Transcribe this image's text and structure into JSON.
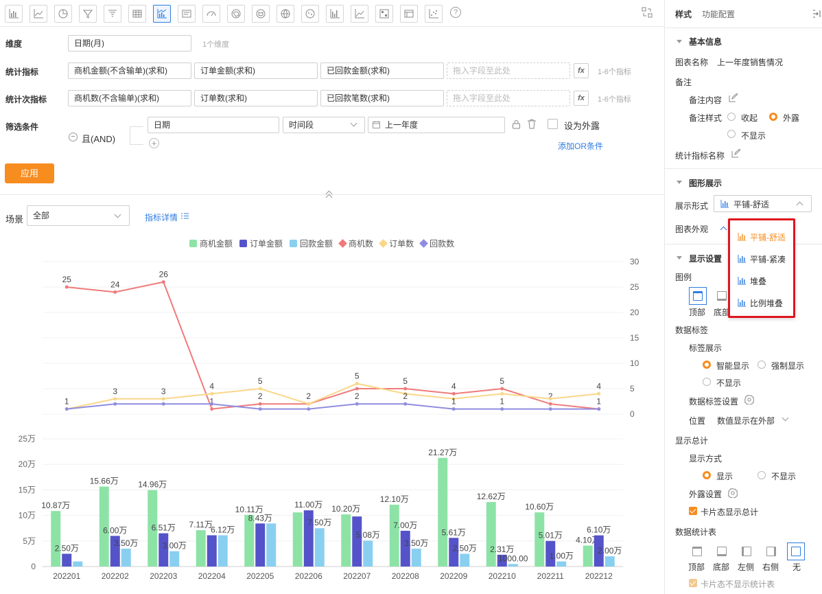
{
  "toolbar": {
    "icons": [
      "bar-chart-icon",
      "line-chart-icon",
      "pie-chart-icon",
      "funnel-icon",
      "funnel-bars-icon",
      "table-icon",
      "combo-chart-icon",
      "text-card-icon",
      "gauge-icon",
      "map-cn-icon",
      "map-cn-alt-icon",
      "globe-icon",
      "scatter-map-icon",
      "column-icon",
      "area-chart-icon",
      "heat-grid-icon",
      "list-table-icon",
      "scatter-icon"
    ],
    "active_index": 6,
    "help": "?"
  },
  "config": {
    "dimension_label": "维度",
    "dimension_value": "日期(月)",
    "dimension_hint": "1个维度",
    "metric_label": "统计指标",
    "metrics": [
      "商机金额(不含输单)(求和)",
      "订单金额(求和)",
      "已回款金额(求和)"
    ],
    "metric_placeholder": "拖入字段至此处",
    "metric_hint": "1-6个指标",
    "fx": "fx",
    "submetric_label": "统计次指标",
    "submetrics": [
      "商机数(不含输单)(求和)",
      "订单数(求和)",
      "已回款笔数(求和)"
    ],
    "submetric_placeholder": "拖入字段至此处",
    "submetric_hint": "1-6个指标",
    "filter_label": "筛选条件",
    "filter_and": "且(AND)",
    "filter_field": "日期",
    "filter_op": "时间段",
    "filter_value": "上一年度",
    "filter_expose": "设为外露",
    "add_or": "添加OR条件",
    "apply": "应用"
  },
  "scene": {
    "label": "场景",
    "value": "全部",
    "detail_link": "指标详情"
  },
  "chart_data": {
    "type": "bar",
    "categories": [
      "202201",
      "202202",
      "202203",
      "202204",
      "202205",
      "202206",
      "202207",
      "202208",
      "202209",
      "202210",
      "202211",
      "202212"
    ],
    "series": [
      {
        "name": "商机金额",
        "kind": "bar",
        "color": "#8de3a6",
        "values": [
          10.87,
          15.66,
          14.96,
          7.11,
          10.11,
          10.6,
          10.2,
          12.1,
          21.27,
          12.62,
          10.6,
          4.1
        ],
        "labels": [
          "10.87万",
          "15.66万",
          "14.96万",
          "7.11万",
          "10.11万",
          "",
          "10.20万",
          "12.10万",
          "21.27万",
          "12.62万",
          "10.60万",
          "4.10万"
        ]
      },
      {
        "name": "订单金额",
        "kind": "bar",
        "color": "#5553c9",
        "values": [
          2.5,
          6.0,
          6.51,
          6.12,
          8.43,
          11.0,
          9.8,
          7.0,
          5.61,
          2.31,
          5.01,
          6.1
        ],
        "labels": [
          "2.50万",
          "6.00万",
          "6.51万",
          "",
          "8.43万",
          "11.00万",
          "",
          "7.00万",
          "5.61万",
          "2.31万",
          "5.01万",
          "6.10万"
        ]
      },
      {
        "name": "回款金额",
        "kind": "bar",
        "color": "#89cff0",
        "values": [
          1.0,
          3.5,
          3.0,
          6.12,
          8.43,
          7.5,
          5.08,
          3.5,
          2.5,
          0.5,
          1.0,
          2.0
        ],
        "labels": [
          "",
          "3.50万",
          "3.00万",
          "6.12万",
          "",
          "7.50万",
          "5.08万",
          "3.50万",
          "2.50万",
          "1000.00",
          "1.00万",
          "2.00万"
        ]
      },
      {
        "name": "商机数",
        "kind": "line",
        "color": "#f07a7a",
        "values": [
          25,
          24,
          26,
          1,
          2,
          2,
          5,
          5,
          4,
          5,
          2,
          1
        ],
        "labels": [
          "25",
          "24",
          "26",
          "1",
          "2",
          "2",
          "",
          "5",
          "4",
          "5",
          "2",
          "1"
        ]
      },
      {
        "name": "订单数",
        "kind": "line",
        "color": "#f9d78a",
        "values": [
          1,
          3,
          3,
          4,
          5,
          2,
          6,
          4,
          3,
          4,
          3,
          4
        ],
        "labels": [
          "",
          "3",
          "3",
          "4",
          "5",
          "",
          "5",
          "",
          "",
          "",
          "",
          "4"
        ]
      },
      {
        "name": "回款数",
        "kind": "line",
        "color": "#8f8de0",
        "values": [
          1,
          2,
          2,
          2,
          1,
          1,
          2,
          2,
          1,
          1,
          1,
          1
        ],
        "labels": [
          "1",
          "",
          "",
          "",
          "",
          "",
          "2",
          "2",
          "1",
          "1",
          "",
          ""
        ]
      }
    ],
    "line_axis": {
      "ticks": [
        "30",
        "25",
        "20",
        "15",
        "10",
        "5",
        "0"
      ],
      "ylim": [
        0,
        30
      ]
    },
    "bar_axis": {
      "ticks": [
        "25万",
        "20万",
        "15万",
        "10万",
        "5万",
        "0"
      ],
      "ylim": [
        0,
        25
      ]
    },
    "legend": "top"
  },
  "panel": {
    "tab_style": "样式",
    "tab_func": "功能配置",
    "basic_title": "基本信息",
    "chart_name_label": "图表名称",
    "chart_name_value": "上一年度销售情况",
    "note_label": "备注",
    "note_content_label": "备注内容",
    "note_style_label": "备注样式",
    "note_opt1": "收起",
    "note_opt2": "外露",
    "note_opt3": "不显示",
    "metric_name_label": "统计指标名称",
    "graph_title": "图形展示",
    "display_form_label": "展示形式",
    "display_form_value": "平铺-舒适",
    "appearance_label": "图表外观",
    "display_settings_title": "显示设置",
    "legend_label": "图例",
    "legend_top": "顶部",
    "legend_bottom": "底部",
    "data_label_title": "数据标签",
    "label_show_label": "标签展示",
    "label_opt1": "智能显示",
    "label_opt2": "强制显示",
    "label_opt3": "不显示",
    "label_setting": "数据标签设置",
    "position_label": "位置",
    "position_value": "数值显示在外部",
    "total_title": "显示总计",
    "total_mode_label": "显示方式",
    "total_opt1": "显示",
    "total_opt2": "不显示",
    "expose_setting": "外露设置",
    "card_total": "卡片态显示总计",
    "stats_table_title": "数据统计表",
    "stats_pos": [
      "顶部",
      "底部",
      "左侧",
      "右侧",
      "无"
    ],
    "card_no_stats": "卡片态不显示统计表",
    "dropdown": [
      "平铺-舒适",
      "平铺-紧凑",
      "堆叠",
      "比例堆叠"
    ]
  },
  "colors": {
    "accent": "#f78c1f",
    "link": "#2f7ce0",
    "highlight": "#e0141e"
  }
}
